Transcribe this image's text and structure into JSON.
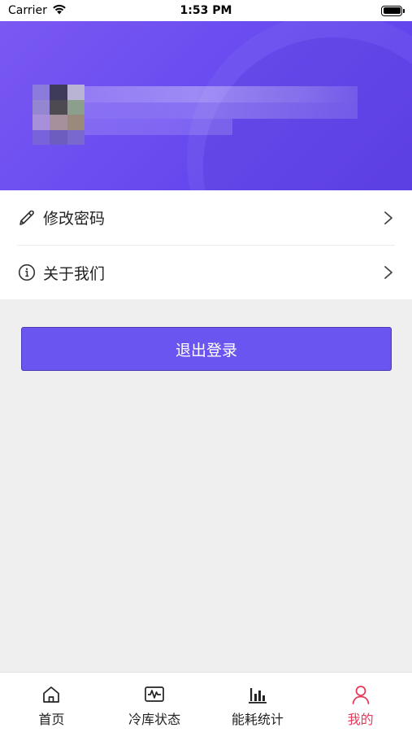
{
  "status_bar": {
    "carrier": "Carrier",
    "time": "1:53 PM"
  },
  "profile": {
    "avatar_icon": "pixelated-avatar"
  },
  "menu": {
    "items": [
      {
        "label": "修改密码",
        "icon": "pencil-icon"
      },
      {
        "label": "关于我们",
        "icon": "info-icon"
      }
    ]
  },
  "logout": {
    "label": "退出登录"
  },
  "tab_bar": {
    "tabs": [
      {
        "label": "首页",
        "icon": "home-icon"
      },
      {
        "label": "冷库状态",
        "icon": "monitor-wave-icon"
      },
      {
        "label": "能耗统计",
        "icon": "bar-chart-icon"
      },
      {
        "label": "我的",
        "icon": "user-icon"
      }
    ],
    "active_index": 3
  },
  "colors": {
    "accent": "#6a55f0",
    "active_tab": "#e8395a",
    "banner": "#6a4cf0"
  }
}
